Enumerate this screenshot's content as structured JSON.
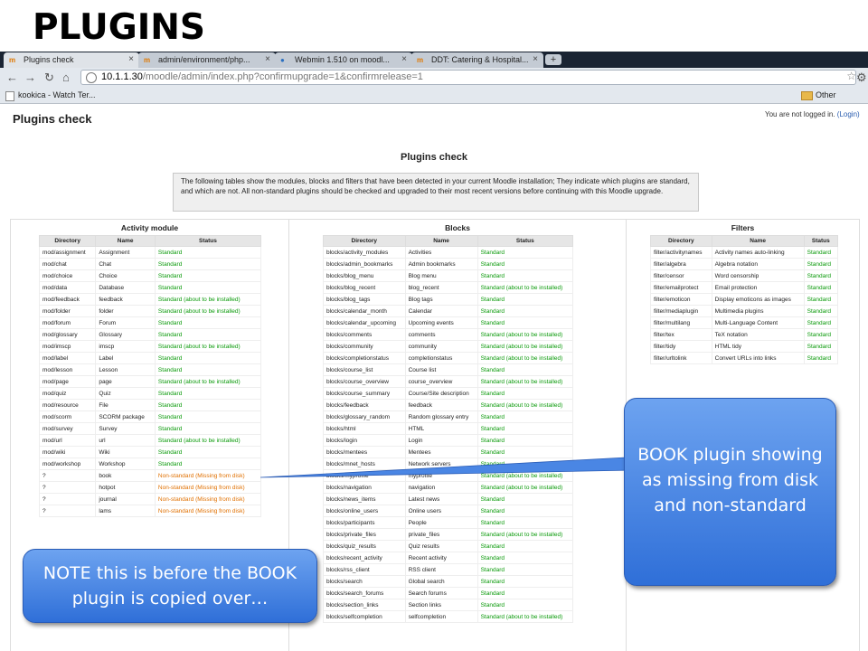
{
  "slide_title": "PLUGINS",
  "browser": {
    "tabs": [
      {
        "label": "Plugins check",
        "active": true
      },
      {
        "label": "admin/environment/php..."
      },
      {
        "label": "Webmin 1.510 on moodl..."
      },
      {
        "label": "DDT: Catering & Hospital..."
      }
    ],
    "new_tab": "+",
    "url_host": "10.1.1.30",
    "url_path": "/moodle/admin/index.php?confirmupgrade=1&confirmrelease=1",
    "bookmark_left": "kookica - Watch Ter...",
    "bookmark_right": "Other bookmarks"
  },
  "page": {
    "heading": "Plugins check",
    "login_text": "You are not logged in.",
    "login_link": "(Login)",
    "center_title": "Plugins check",
    "info_text": "The following tables show the modules, blocks and filters that have been detected in your current Moodle installation; They indicate which plugins are standard, and which are not. All non-standard plugins should be checked and upgraded to their most recent versions before continuing with this Moodle upgrade."
  },
  "columns": [
    "Directory",
    "Name",
    "Status"
  ],
  "activity": {
    "title": "Activity module",
    "rows": [
      [
        "mod/assignment",
        "Assignment",
        "Standard"
      ],
      [
        "mod/chat",
        "Chat",
        "Standard"
      ],
      [
        "mod/choice",
        "Choice",
        "Standard"
      ],
      [
        "mod/data",
        "Database",
        "Standard"
      ],
      [
        "mod/feedback",
        "feedback",
        "Standard (about to be installed)"
      ],
      [
        "mod/folder",
        "folder",
        "Standard (about to be installed)"
      ],
      [
        "mod/forum",
        "Forum",
        "Standard"
      ],
      [
        "mod/glossary",
        "Glossary",
        "Standard"
      ],
      [
        "mod/imscp",
        "imscp",
        "Standard (about to be installed)"
      ],
      [
        "mod/label",
        "Label",
        "Standard"
      ],
      [
        "mod/lesson",
        "Lesson",
        "Standard"
      ],
      [
        "mod/page",
        "page",
        "Standard (about to be installed)"
      ],
      [
        "mod/quiz",
        "Quiz",
        "Standard"
      ],
      [
        "mod/resource",
        "File",
        "Standard"
      ],
      [
        "mod/scorm",
        "SCORM package",
        "Standard"
      ],
      [
        "mod/survey",
        "Survey",
        "Standard"
      ],
      [
        "mod/url",
        "url",
        "Standard (about to be installed)"
      ],
      [
        "mod/wiki",
        "Wiki",
        "Standard"
      ],
      [
        "mod/workshop",
        "Workshop",
        "Standard"
      ],
      [
        "?",
        "book",
        "Non-standard (Missing from disk)"
      ],
      [
        "?",
        "hotpot",
        "Non-standard (Missing from disk)"
      ],
      [
        "?",
        "journal",
        "Non-standard (Missing from disk)"
      ],
      [
        "?",
        "lams",
        "Non-standard (Missing from disk)"
      ]
    ]
  },
  "blocks": {
    "title": "Blocks",
    "rows": [
      [
        "blocks/activity_modules",
        "Activities",
        "Standard"
      ],
      [
        "blocks/admin_bookmarks",
        "Admin bookmarks",
        "Standard"
      ],
      [
        "blocks/blog_menu",
        "Blog menu",
        "Standard"
      ],
      [
        "blocks/blog_recent",
        "blog_recent",
        "Standard (about to be installed)"
      ],
      [
        "blocks/blog_tags",
        "Blog tags",
        "Standard"
      ],
      [
        "blocks/calendar_month",
        "Calendar",
        "Standard"
      ],
      [
        "blocks/calendar_upcoming",
        "Upcoming events",
        "Standard"
      ],
      [
        "blocks/comments",
        "comments",
        "Standard (about to be installed)"
      ],
      [
        "blocks/community",
        "community",
        "Standard (about to be installed)"
      ],
      [
        "blocks/completionstatus",
        "completionstatus",
        "Standard (about to be installed)"
      ],
      [
        "blocks/course_list",
        "Course list",
        "Standard"
      ],
      [
        "blocks/course_overview",
        "course_overview",
        "Standard (about to be installed)"
      ],
      [
        "blocks/course_summary",
        "Course/Site description",
        "Standard"
      ],
      [
        "blocks/feedback",
        "feedback",
        "Standard (about to be installed)"
      ],
      [
        "blocks/glossary_random",
        "Random glossary entry",
        "Standard"
      ],
      [
        "blocks/html",
        "HTML",
        "Standard"
      ],
      [
        "blocks/login",
        "Login",
        "Standard"
      ],
      [
        "blocks/mentees",
        "Mentees",
        "Standard"
      ],
      [
        "blocks/mnet_hosts",
        "Network servers",
        "Standard"
      ],
      [
        "blocks/myprofile",
        "myprofile",
        "Standard (about to be installed)"
      ],
      [
        "blocks/navigation",
        "navigation",
        "Standard (about to be installed)"
      ],
      [
        "blocks/news_items",
        "Latest news",
        "Standard"
      ],
      [
        "blocks/online_users",
        "Online users",
        "Standard"
      ],
      [
        "blocks/participants",
        "People",
        "Standard"
      ],
      [
        "blocks/private_files",
        "private_files",
        "Standard (about to be installed)"
      ],
      [
        "blocks/quiz_results",
        "Quiz results",
        "Standard"
      ],
      [
        "blocks/recent_activity",
        "Recent activity",
        "Standard"
      ],
      [
        "blocks/rss_client",
        "RSS client",
        "Standard"
      ],
      [
        "blocks/search",
        "Global search",
        "Standard"
      ],
      [
        "blocks/search_forums",
        "Search forums",
        "Standard"
      ],
      [
        "blocks/section_links",
        "Section links",
        "Standard"
      ],
      [
        "blocks/selfcompletion",
        "selfcompletion",
        "Standard (about to be installed)"
      ]
    ]
  },
  "filters": {
    "title": "Filters",
    "rows": [
      [
        "filter/activitynames",
        "Activity names auto-linking",
        "Standard"
      ],
      [
        "filter/algebra",
        "Algebra notation",
        "Standard"
      ],
      [
        "filter/censor",
        "Word censorship",
        "Standard"
      ],
      [
        "filter/emailprotect",
        "Email protection",
        "Standard"
      ],
      [
        "filter/emoticon",
        "Display emoticons as images",
        "Standard"
      ],
      [
        "filter/mediaplugin",
        "Multimedia plugins",
        "Standard"
      ],
      [
        "filter/multilang",
        "Multi-Language Content",
        "Standard"
      ],
      [
        "filter/tex",
        "TeX notation",
        "Standard"
      ],
      [
        "filter/tidy",
        "HTML tidy",
        "Standard"
      ],
      [
        "filter/urltolink",
        "Convert URLs into links",
        "Standard"
      ]
    ]
  },
  "callouts": {
    "book": "BOOK plugin showing as missing from disk and non-standard",
    "note": "NOTE this is before the BOOK plugin is copied over…"
  },
  "colors": {
    "standard": "#0a9a0a",
    "non_standard": "#e07000",
    "callout_blue": "#3f7fe0"
  }
}
